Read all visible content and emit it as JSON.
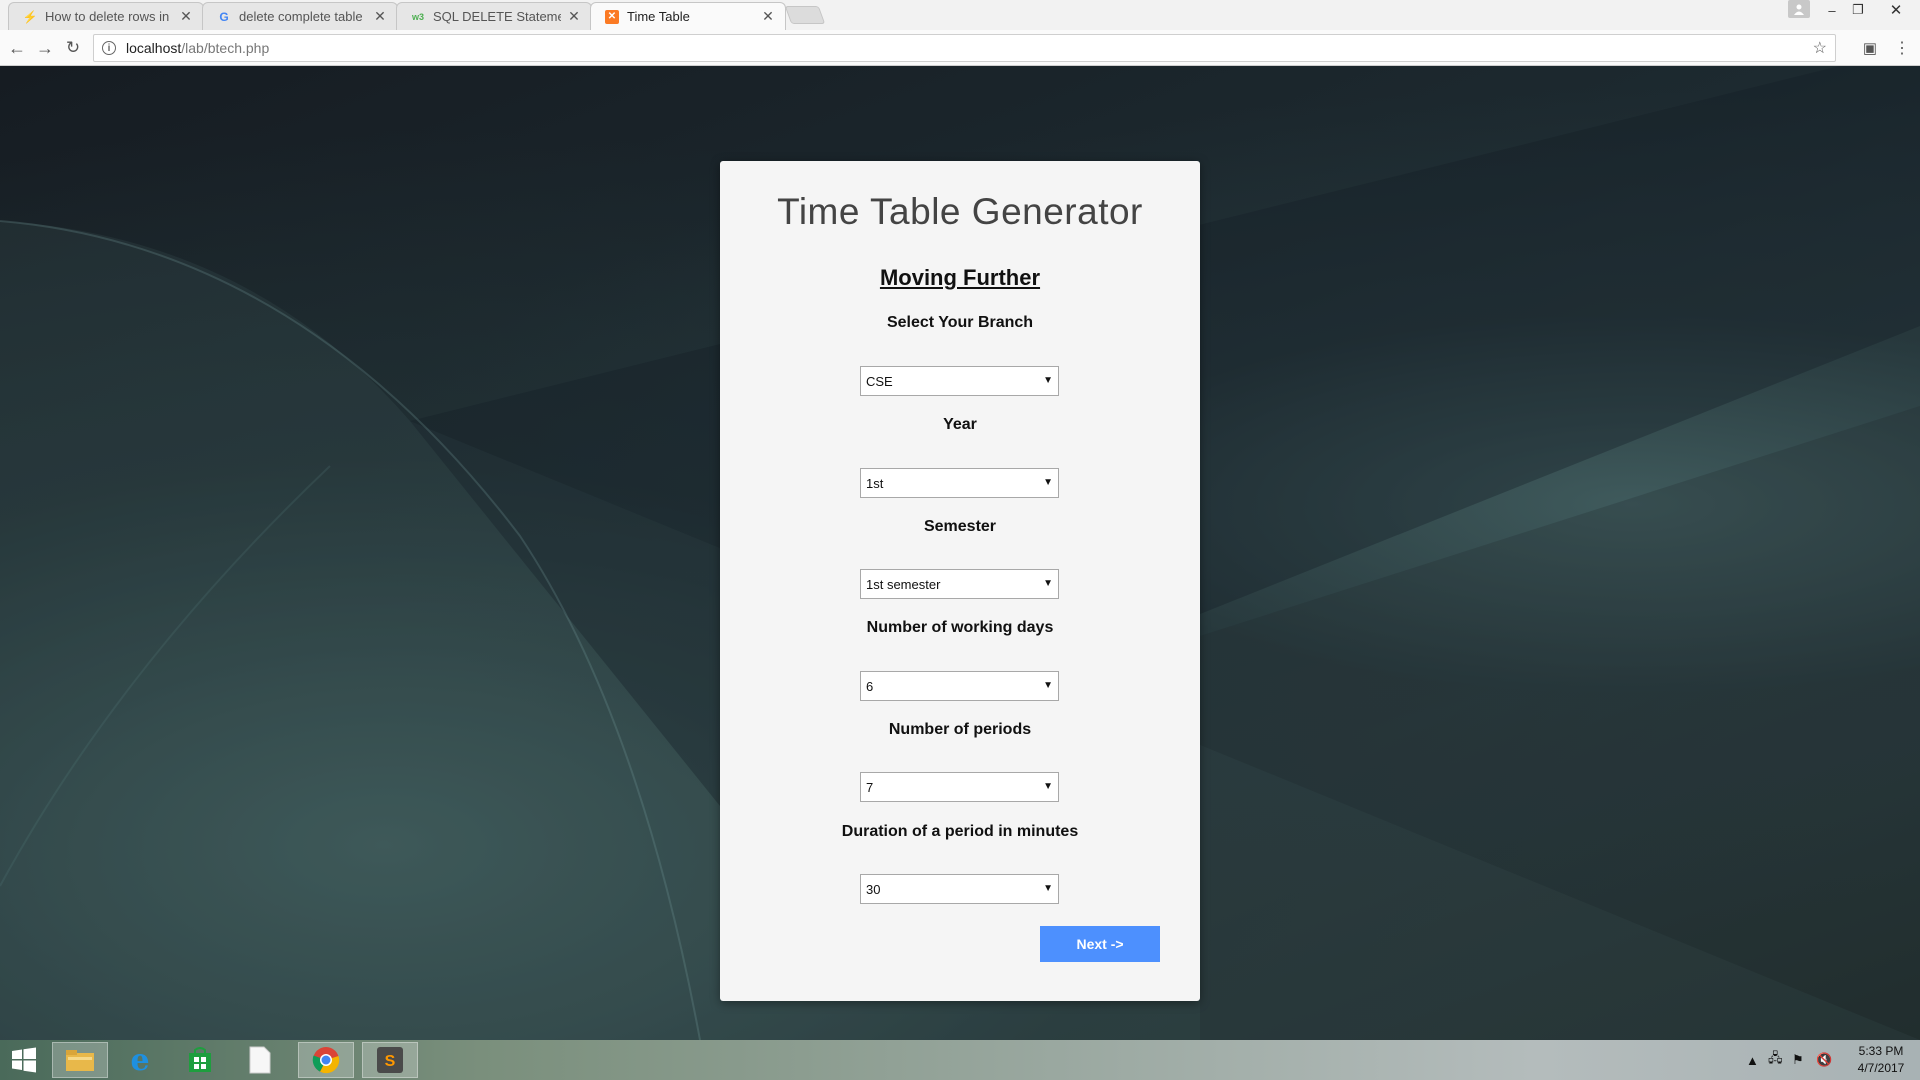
{
  "browser": {
    "tabs": [
      {
        "title": "How to delete rows in m",
        "icon": "stack-overflow-icon",
        "active": false
      },
      {
        "title": "delete complete table in",
        "icon": "google-icon",
        "active": false
      },
      {
        "title": "SQL DELETE Statement",
        "icon": "w3schools-icon",
        "active": false
      },
      {
        "title": "Time Table",
        "icon": "xampp-icon",
        "active": true
      }
    ],
    "address": {
      "host": "localhost",
      "path": "/lab/btech.php"
    }
  },
  "page": {
    "title": "Time Table Generator",
    "subtitle": "Moving Further",
    "fields": [
      {
        "label": "Select Your Branch",
        "value": "CSE"
      },
      {
        "label": "Year",
        "value": "1st"
      },
      {
        "label": "Semester",
        "value": "1st semester"
      },
      {
        "label": "Number of working days",
        "value": "6"
      },
      {
        "label": "Number of periods",
        "value": "7"
      },
      {
        "label": "Duration of a period in minutes",
        "value": "30"
      }
    ],
    "next_label": "Next ->",
    "accent_color": "#4d90fe"
  },
  "taskbar": {
    "apps": [
      "start-icon",
      "file-explorer-icon",
      "internet-explorer-icon",
      "store-icon",
      "notepad-icon",
      "chrome-icon",
      "sublime-text-icon"
    ],
    "time": "5:33 PM",
    "date": "4/7/2017"
  }
}
